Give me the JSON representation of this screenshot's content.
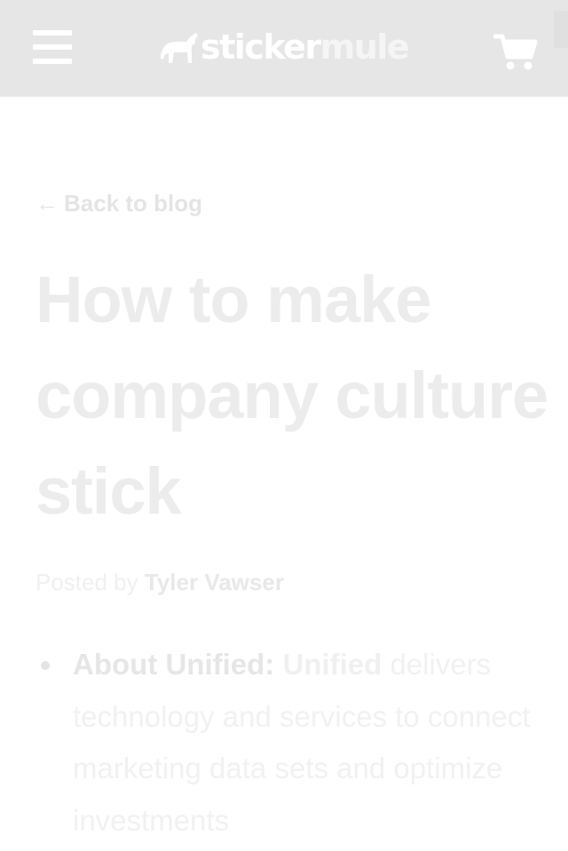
{
  "header": {
    "menu_icon": "hamburger-menu-icon",
    "logo": {
      "part1": "sticker",
      "part2": "mule",
      "icon": "mule-logo-icon"
    },
    "cart_icon": "shopping-cart-icon",
    "background_color": "#e6e6e6"
  },
  "article": {
    "back_link": {
      "arrow": "←",
      "label": "Back to blog"
    },
    "title": "How to make company culture stick",
    "byline": {
      "prefix": "Posted by",
      "author": "Tyler Vawser"
    },
    "bullets": [
      {
        "lead": "About Unified:",
        "link": "Unified",
        "text": "delivers technology and services to connect marketing data sets and optimize investments"
      }
    ]
  }
}
